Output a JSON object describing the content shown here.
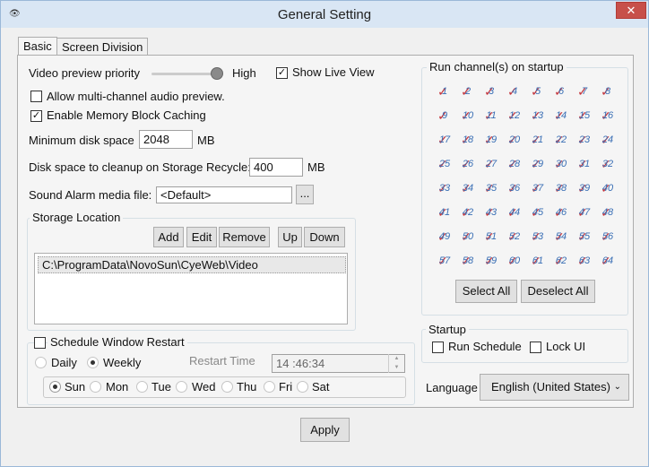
{
  "window": {
    "title": "General Setting",
    "close": "✕"
  },
  "tabs": [
    {
      "label": "Basic"
    },
    {
      "label": "Screen Division"
    }
  ],
  "video_priority": {
    "label": "Video preview priority",
    "value": "High"
  },
  "show_live_view": {
    "label": "Show Live View",
    "checked": true
  },
  "allow_audio": {
    "label": "Allow multi-channel audio preview.",
    "checked": false
  },
  "memory_caching": {
    "label": "Enable Memory Block Caching",
    "checked": true
  },
  "min_disk": {
    "label": "Minimum disk space",
    "value": "2048",
    "unit": "MB"
  },
  "cleanup_disk": {
    "label": "Disk space to cleanup on Storage Recycle:",
    "value": "400",
    "unit": "MB"
  },
  "sound_alarm": {
    "label": "Sound Alarm media file:",
    "value": "<Default>",
    "browse": "..."
  },
  "storage": {
    "legend": "Storage Location",
    "buttons": {
      "add": "Add",
      "edit": "Edit",
      "remove": "Remove",
      "up": "Up",
      "down": "Down"
    },
    "paths": [
      "C:\\ProgramData\\NovoSun\\CyeWeb\\Video"
    ]
  },
  "schedule": {
    "label": "Schedule Window Restart",
    "checked": false,
    "daily": "Daily",
    "weekly": "Weekly",
    "restart_time_label": "Restart Time",
    "restart_time": "14 :46:34",
    "days": [
      "Sun",
      "Mon",
      "Tue",
      "Wed",
      "Thu",
      "Fri",
      "Sat"
    ]
  },
  "run_channels": {
    "legend": "Run channel(s) on startup",
    "channels": [
      "1",
      "2",
      "3",
      "4",
      "5",
      "6",
      "7",
      "8",
      "9",
      "10",
      "11",
      "12",
      "13",
      "14",
      "15",
      "16",
      "17",
      "18",
      "19",
      "20",
      "21",
      "22",
      "23",
      "24",
      "25",
      "26",
      "27",
      "28",
      "29",
      "30",
      "31",
      "32",
      "33",
      "34",
      "35",
      "36",
      "37",
      "38",
      "39",
      "40",
      "41",
      "42",
      "43",
      "44",
      "45",
      "46",
      "47",
      "48",
      "49",
      "50",
      "51",
      "52",
      "53",
      "54",
      "55",
      "56",
      "57",
      "58",
      "59",
      "60",
      "61",
      "62",
      "63",
      "64"
    ],
    "select_all": "Select All",
    "deselect_all": "Deselect All"
  },
  "startup": {
    "legend": "Startup",
    "run_schedule": "Run Schedule",
    "lock_ui": "Lock UI"
  },
  "language": {
    "label": "Language",
    "value": "English (United States)"
  },
  "apply": "Apply"
}
